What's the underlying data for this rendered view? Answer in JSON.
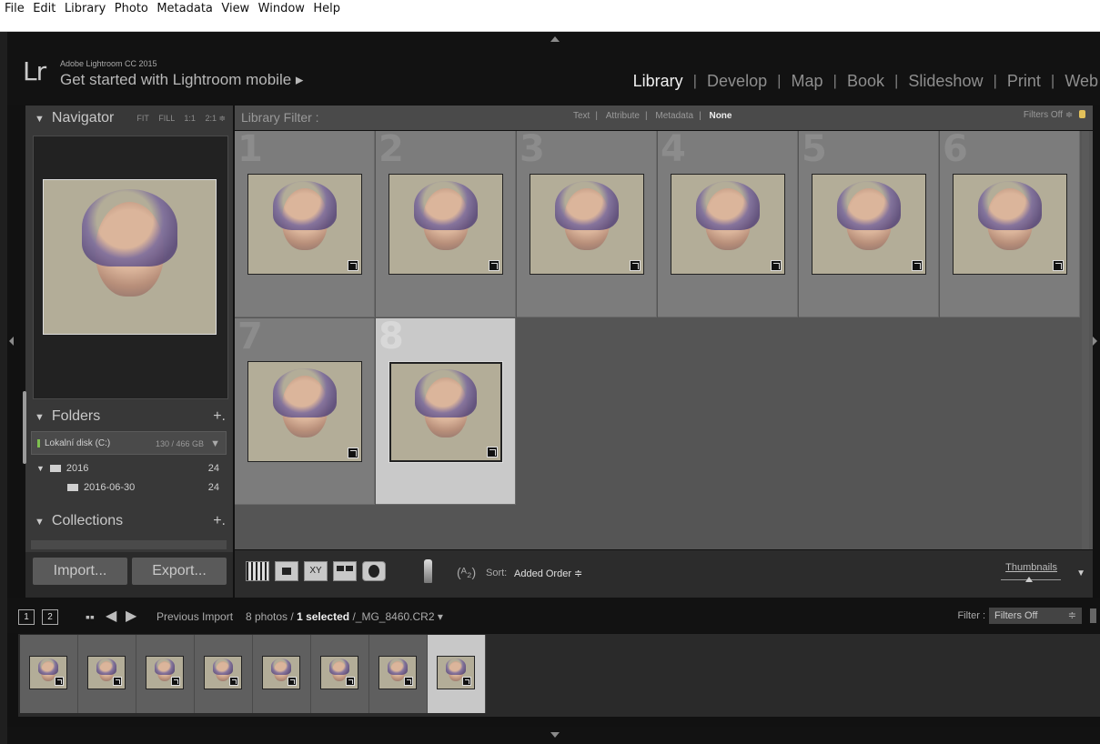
{
  "menubar": [
    "File",
    "Edit",
    "Library",
    "Photo",
    "Metadata",
    "View",
    "Window",
    "Help"
  ],
  "identity": {
    "logo": "Lr",
    "version": "Adobe Lightroom CC 2015",
    "mobile": "Get started with Lightroom mobile ▸"
  },
  "modules": [
    {
      "label": "Library",
      "active": true
    },
    {
      "label": "Develop"
    },
    {
      "label": "Map"
    },
    {
      "label": "Book"
    },
    {
      "label": "Slideshow"
    },
    {
      "label": "Print"
    },
    {
      "label": "Web"
    }
  ],
  "navigator": {
    "title": "Navigator",
    "options": [
      "FIT",
      "FILL",
      "1:1",
      "2:1 ≑"
    ]
  },
  "folders": {
    "title": "Folders",
    "disk": {
      "name": "Lokalní disk (C:)",
      "size": "130 / 466 GB"
    },
    "items": [
      {
        "name": "2016",
        "count": "24"
      },
      {
        "name": "2016-06-30",
        "count": "24"
      }
    ]
  },
  "collections": {
    "title": "Collections"
  },
  "buttons": {
    "import": "Import...",
    "export": "Export..."
  },
  "filterbar": {
    "title": "Library Filter :",
    "options": [
      "Text",
      "Attribute",
      "Metadata",
      "None"
    ],
    "selected": "None",
    "filters_off": "Filters Off ≑"
  },
  "grid": {
    "cells": [
      {
        "num": "1"
      },
      {
        "num": "2"
      },
      {
        "num": "3"
      },
      {
        "num": "4"
      },
      {
        "num": "5"
      },
      {
        "num": "6"
      },
      {
        "num": "7"
      },
      {
        "num": "8",
        "selected": true
      }
    ]
  },
  "toolbar": {
    "sort_label": "Sort:",
    "sort_value": "Added Order ≑",
    "thumbs_label": "Thumbnails"
  },
  "filmstrip_bar": {
    "pages": [
      "1",
      "2"
    ],
    "prev_import": "Previous Import",
    "count": "8 photos /",
    "selected": "1 selected",
    "file": "/_MG_8460.CR2 ▾",
    "filter_label": "Filter :",
    "filter_value": "Filters Off"
  },
  "filmstrip": {
    "thumbs": 8,
    "selected_index": 7
  },
  "colors": {
    "app_bg": "#111111",
    "panel": "#383838",
    "grid_cell": "#7c7c7c",
    "selected_cell": "#c9c9c9"
  }
}
